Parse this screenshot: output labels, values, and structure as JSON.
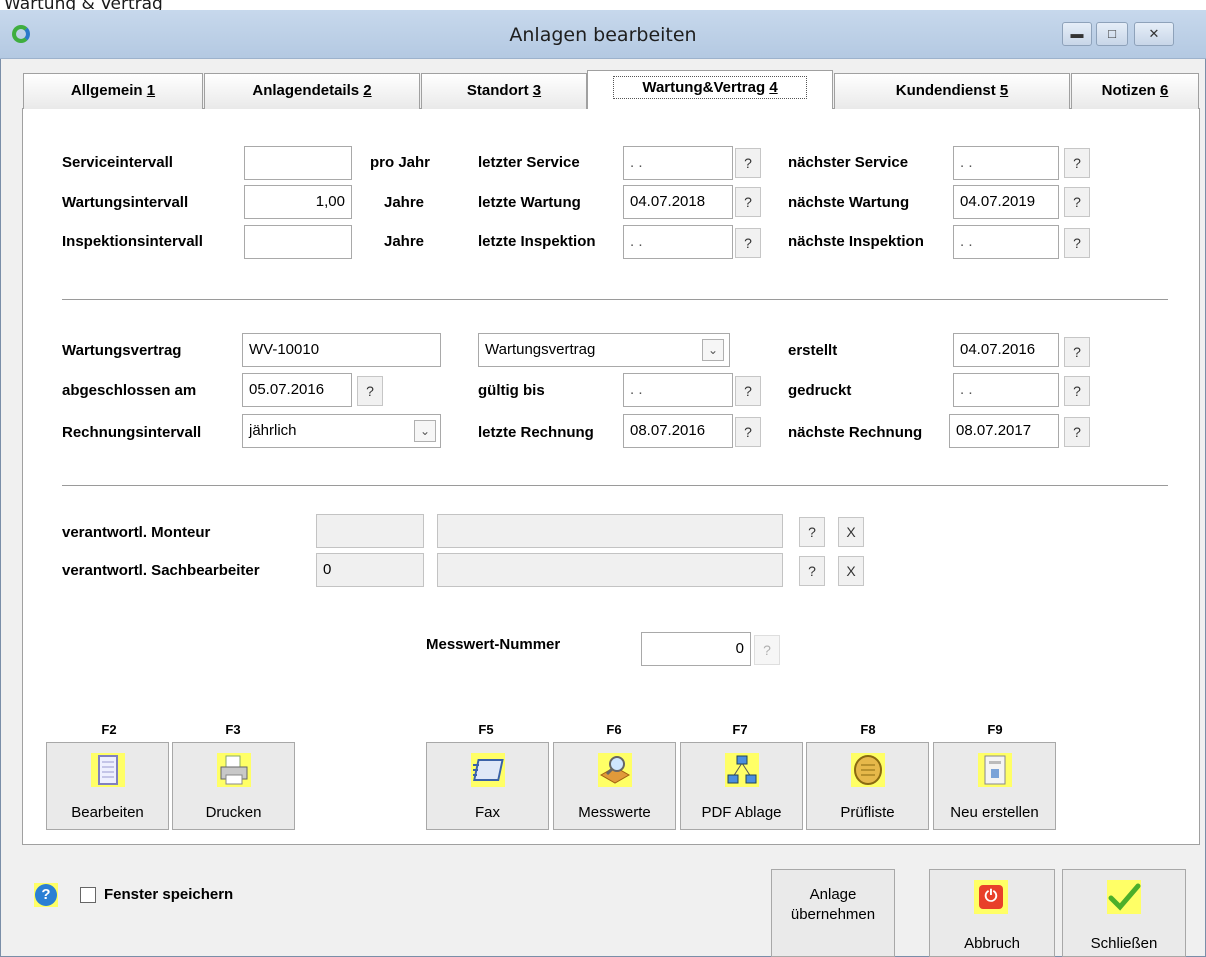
{
  "caption": "Wartung & Vertrag",
  "window": {
    "title": "Anlagen bearbeiten"
  },
  "tabs": [
    {
      "label": "Allgemein",
      "key": "1"
    },
    {
      "label": "Anlagendetails",
      "key": "2"
    },
    {
      "label": "Standort",
      "key": "3"
    },
    {
      "label": "Wartung&Vertrag",
      "key": "4"
    },
    {
      "label": "Kundendienst",
      "key": "5"
    },
    {
      "label": "Notizen",
      "key": "6"
    }
  ],
  "intervals": {
    "service_label": "Serviceintervall",
    "service_value": "",
    "service_unit": "pro Jahr",
    "wartung_label": "Wartungsintervall",
    "wartung_value": "1,00",
    "wartung_unit": "Jahre",
    "inspektion_label": "Inspektionsintervall",
    "inspektion_value": "",
    "inspektion_unit": "Jahre",
    "last_service_label": "letzter Service",
    "last_service_value": ". .",
    "last_wartung_label": "letzte Wartung",
    "last_wartung_value": "04.07.2018",
    "last_inspektion_label": "letzte Inspektion",
    "last_inspektion_value": ". .",
    "next_service_label": "nächster Service",
    "next_service_value": ". .",
    "next_wartung_label": "nächste Wartung",
    "next_wartung_value": "04.07.2019",
    "next_inspektion_label": "nächste Inspektion",
    "next_inspektion_value": ". ."
  },
  "contract": {
    "vertrag_label": "Wartungsvertrag",
    "vertrag_value": "WV-10010",
    "vertrag_type": "Wartungsvertrag",
    "erstellt_label": "erstellt",
    "erstellt_value": "04.07.2016",
    "abgeschlossen_label": "abgeschlossen am",
    "abgeschlossen_value": "05.07.2016",
    "gueltig_label": "gültig bis",
    "gueltig_value": ". .",
    "gedruckt_label": "gedruckt",
    "gedruckt_value": ". .",
    "rechnungsintervall_label": "Rechnungsintervall",
    "rechnungsintervall_value": "jährlich",
    "letzte_rechnung_label": "letzte Rechnung",
    "letzte_rechnung_value": "08.07.2016",
    "naechste_rechnung_label": "nächste Rechnung",
    "naechste_rechnung_value": "08.07.2017"
  },
  "responsible": {
    "monteur_label": "verantwortl. Monteur",
    "monteur_id": "",
    "monteur_name": "",
    "sachbearbeiter_label": "verantwortl. Sachbearbeiter",
    "sachbearbeiter_id": "0",
    "sachbearbeiter_name": "",
    "question": "?",
    "clear": "X"
  },
  "messwert": {
    "label": "Messwert-Nummer",
    "value": "0"
  },
  "toolbar": [
    {
      "fkey": "F2",
      "label": "Bearbeiten",
      "icon": "notepad-icon"
    },
    {
      "fkey": "F3",
      "label": "Drucken",
      "icon": "printer-icon"
    },
    {
      "fkey": "F5",
      "label": "Fax",
      "icon": "fax-icon"
    },
    {
      "fkey": "F6",
      "label": "Messwerte",
      "icon": "measure-icon"
    },
    {
      "fkey": "F7",
      "label": "PDF Ablage",
      "icon": "network-icon"
    },
    {
      "fkey": "F8",
      "label": "Prüfliste",
      "icon": "checklist-icon"
    },
    {
      "fkey": "F9",
      "label": "Neu erstellen",
      "icon": "document-new-icon"
    }
  ],
  "footer": {
    "save_window_label": "Fenster speichern",
    "anlage_label_1": "Anlage",
    "anlage_label_2": "übernehmen",
    "abbruch_label": "Abbruch",
    "schliessen_label": "Schließen"
  },
  "colors": {
    "icon_bg": "#ffff66",
    "help_blue": "#2a7fd4",
    "abort_red": "#e8402a",
    "ok_green": "#4caf2a"
  }
}
